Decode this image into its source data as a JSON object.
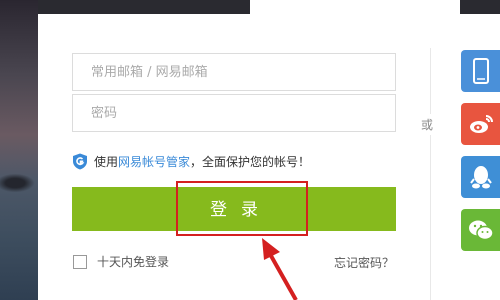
{
  "form": {
    "email_placeholder": "常用邮箱 / 网易邮箱",
    "password_placeholder": "密码",
    "guard_text_prefix": "使用",
    "guard_link": "网易帐号管家",
    "guard_text_suffix": "，全面保护您的帐号！",
    "login_label": "登录",
    "remember_label": "十天内免登录",
    "forgot_label": "忘记密码？",
    "or_label": "或"
  },
  "social": {
    "mobile_icon": "mobile-phone-icon",
    "weibo_icon": "weibo-icon",
    "qq_icon": "qq-icon",
    "wechat_icon": "wechat-icon"
  },
  "colors": {
    "login_button": "#86ba1d",
    "highlight": "#d42020",
    "link": "#3a8ad8"
  }
}
